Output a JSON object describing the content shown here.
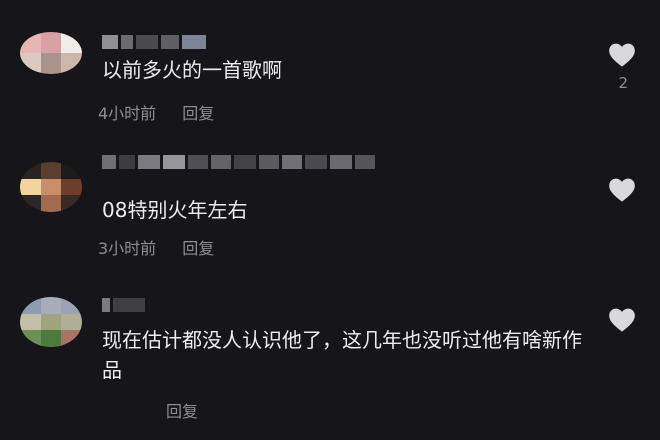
{
  "comments": [
    {
      "text": "以前多火的一首歌啊",
      "time": "4小时前",
      "reply_label": "回复",
      "likes": "2"
    },
    {
      "text": "08特别火年左右",
      "time": "3小时前",
      "reply_label": "回复",
      "likes": ""
    },
    {
      "text": "现在估计都没人认识他了，这几年也没听过他有啥新作品",
      "time": "",
      "reply_label": "回复",
      "likes": ""
    }
  ],
  "icons": {
    "like": "heart-icon"
  },
  "colors": {
    "background": "#16161a",
    "text": "#ededf0",
    "muted": "#8d8d92",
    "heart": "#d9d9dc"
  }
}
